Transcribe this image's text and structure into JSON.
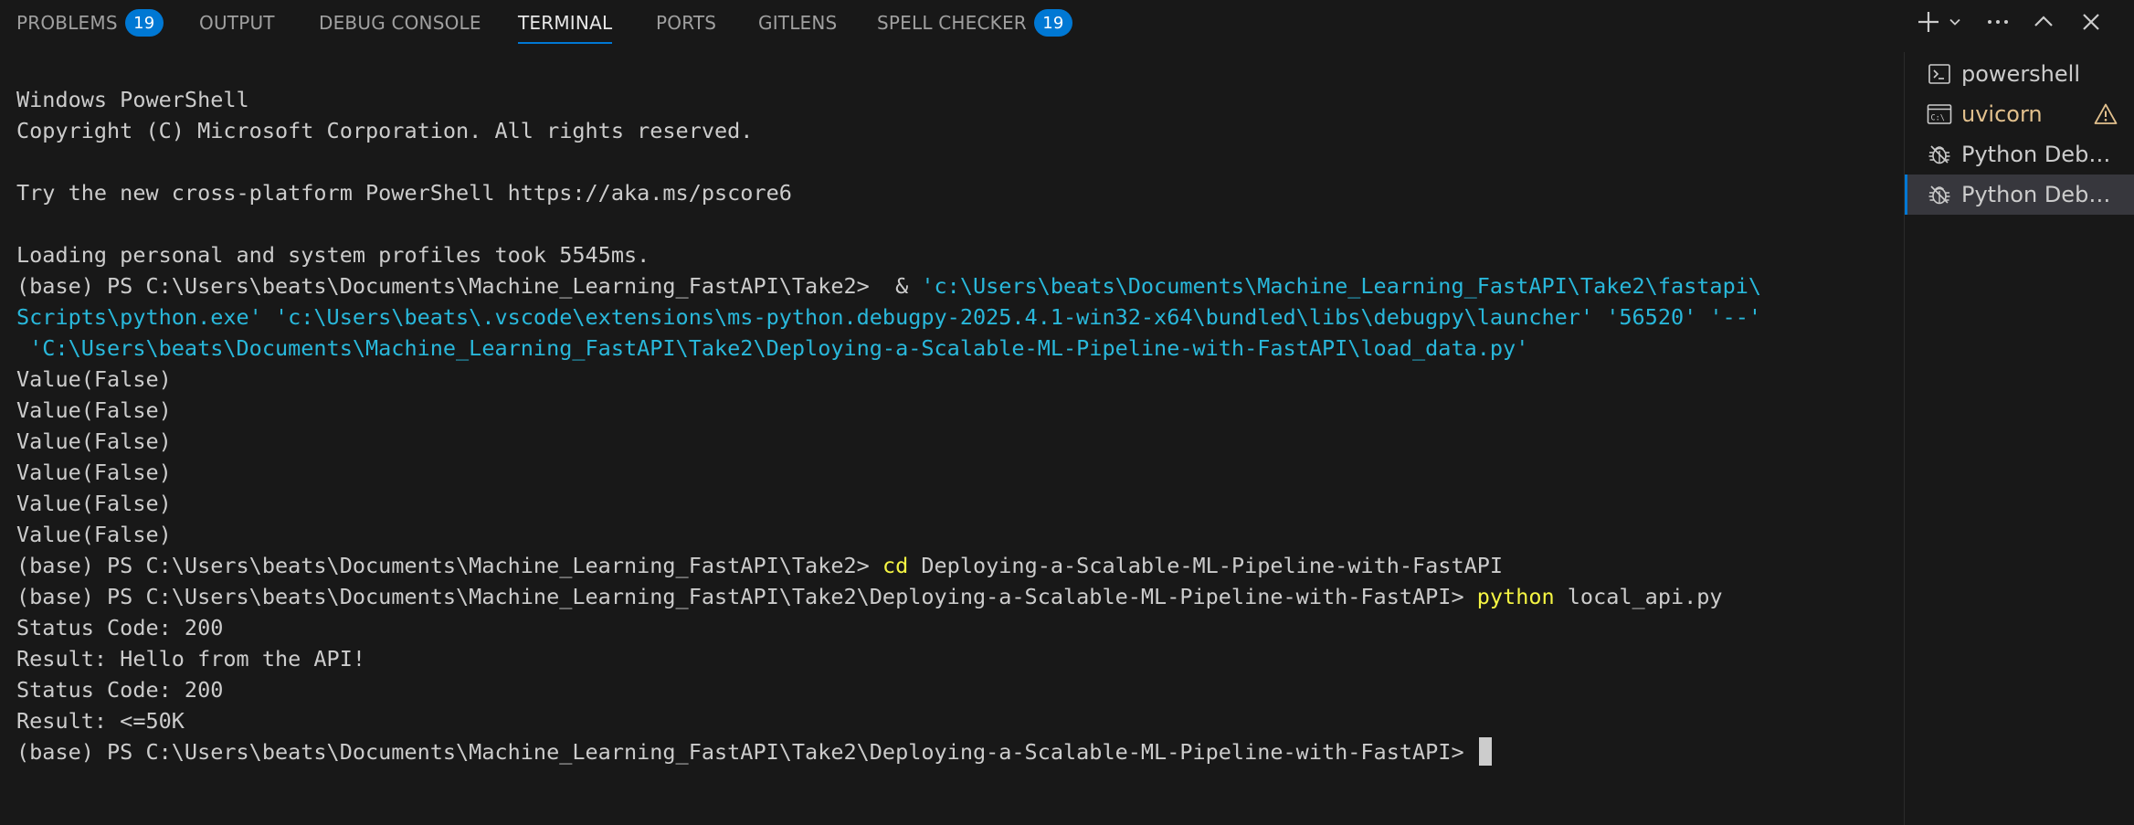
{
  "tabs": [
    {
      "label": "PROBLEMS",
      "badge": "19",
      "active": false
    },
    {
      "label": "OUTPUT",
      "badge": null,
      "active": false
    },
    {
      "label": "DEBUG CONSOLE",
      "badge": null,
      "active": false
    },
    {
      "label": "TERMINAL",
      "badge": null,
      "active": true
    },
    {
      "label": "PORTS",
      "badge": null,
      "active": false
    },
    {
      "label": "GITLENS",
      "badge": null,
      "active": false
    },
    {
      "label": "SPELL CHECKER",
      "badge": "19",
      "active": false
    }
  ],
  "toolbar": {
    "icons": [
      "add-terminal-icon",
      "chevron-down-icon",
      "more-actions-icon",
      "maximize-panel-icon",
      "close-panel-icon"
    ]
  },
  "terminal": {
    "lines": [
      {
        "segments": [
          {
            "text": "Windows PowerShell",
            "style": "plain"
          }
        ]
      },
      {
        "segments": [
          {
            "text": "Copyright (C) Microsoft Corporation. All rights reserved.",
            "style": "plain"
          }
        ]
      },
      {
        "segments": [
          {
            "text": "",
            "style": "plain"
          }
        ]
      },
      {
        "segments": [
          {
            "text": "Try the new cross-platform PowerShell https://aka.ms/pscore6",
            "style": "plain"
          }
        ]
      },
      {
        "segments": [
          {
            "text": "",
            "style": "plain"
          }
        ]
      },
      {
        "segments": [
          {
            "text": "Loading personal and system profiles took 5545ms.",
            "style": "plain"
          }
        ]
      },
      {
        "segments": [
          {
            "text": "(base) PS C:\\Users\\beats\\Documents\\Machine_Learning_FastAPI\\Take2>  & ",
            "style": "plain"
          },
          {
            "text": "'c:\\Users\\beats\\Documents\\Machine_Learning_FastAPI\\Take2\\fastapi\\",
            "style": "path"
          }
        ]
      },
      {
        "segments": [
          {
            "text": "Scripts\\python.exe' 'c:\\Users\\beats\\.vscode\\extensions\\ms-python.debugpy-2025.4.1-win32-x64\\bundled\\libs\\debugpy\\launcher' '56520' '--'",
            "style": "path"
          }
        ]
      },
      {
        "segments": [
          {
            "text": " 'C:\\Users\\beats\\Documents\\Machine_Learning_FastAPI\\Take2\\Deploying-a-Scalable-ML-Pipeline-with-FastAPI\\load_data.py'",
            "style": "path"
          }
        ]
      },
      {
        "segments": [
          {
            "text": "Value(False)",
            "style": "plain"
          }
        ]
      },
      {
        "segments": [
          {
            "text": "Value(False)",
            "style": "plain"
          }
        ]
      },
      {
        "segments": [
          {
            "text": "Value(False)",
            "style": "plain"
          }
        ]
      },
      {
        "segments": [
          {
            "text": "Value(False)",
            "style": "plain"
          }
        ]
      },
      {
        "segments": [
          {
            "text": "Value(False)",
            "style": "plain"
          }
        ]
      },
      {
        "segments": [
          {
            "text": "Value(False)",
            "style": "plain"
          }
        ]
      },
      {
        "segments": [
          {
            "text": "(base) PS C:\\Users\\beats\\Documents\\Machine_Learning_FastAPI\\Take2> ",
            "style": "plain"
          },
          {
            "text": "cd",
            "style": "cmd"
          },
          {
            "text": " Deploying-a-Scalable-ML-Pipeline-with-FastAPI",
            "style": "plain"
          }
        ]
      },
      {
        "segments": [
          {
            "text": "(base) PS C:\\Users\\beats\\Documents\\Machine_Learning_FastAPI\\Take2\\Deploying-a-Scalable-ML-Pipeline-with-FastAPI> ",
            "style": "plain"
          },
          {
            "text": "python",
            "style": "cmd"
          },
          {
            "text": " local_api.py",
            "style": "plain"
          }
        ]
      },
      {
        "segments": [
          {
            "text": "Status Code: 200",
            "style": "plain"
          }
        ]
      },
      {
        "segments": [
          {
            "text": "Result: Hello from the API!",
            "style": "plain"
          }
        ]
      },
      {
        "segments": [
          {
            "text": "Status Code: 200",
            "style": "plain"
          }
        ]
      },
      {
        "segments": [
          {
            "text": "Result: <=50K",
            "style": "plain"
          }
        ]
      },
      {
        "segments": [
          {
            "text": "(base) PS C:\\Users\\beats\\Documents\\Machine_Learning_FastAPI\\Take2\\Deploying-a-Scalable-ML-Pipeline-with-FastAPI> ",
            "style": "plain"
          }
        ],
        "cursor": true
      }
    ]
  },
  "terminal_list": [
    {
      "label": "powershell",
      "icon": "terminal-icon",
      "warning": false,
      "selected": false
    },
    {
      "label": "uvicorn",
      "icon": "cmd-terminal-icon",
      "warning": true,
      "selected": false
    },
    {
      "label": "Python Debug Console",
      "icon": "debug-bug-icon",
      "warning": false,
      "selected": false
    },
    {
      "label": "Python Debug Console",
      "icon": "debug-bug-icon",
      "warning": false,
      "selected": true
    }
  ],
  "colors": {
    "background": "#181818",
    "text": "#cccccc",
    "accent": "#0078d4",
    "path": "#29b8db",
    "command": "#f5f543",
    "warning": "#e2c08d"
  }
}
